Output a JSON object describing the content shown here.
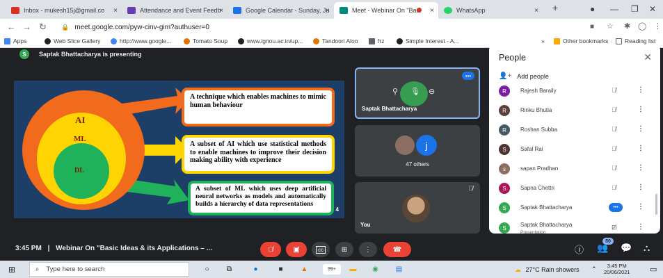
{
  "browser": {
    "tabs": [
      {
        "label": "Inbox - mukesh15j@gmail.co",
        "icon": "gmail-icon",
        "color": "#d93025"
      },
      {
        "label": "Attendance and Event Feedb",
        "icon": "forms-icon",
        "color": "#673ab7"
      },
      {
        "label": "Google Calendar - Sunday, Ju",
        "icon": "calendar-icon",
        "color": "#1a73e8"
      },
      {
        "label": "Meet - Webinar On \"Basi",
        "icon": "meet-icon",
        "color": "#00897b"
      },
      {
        "label": "WhatsApp",
        "icon": "whatsapp-icon",
        "color": "#25d366"
      }
    ],
    "close_glyph": "×",
    "new_tab_glyph": "+",
    "url": "meet.google.com/pyw-cinv-gim?authuser=0",
    "bookmarks": [
      {
        "label": "Apps",
        "color": "#4285f4"
      },
      {
        "label": "Web Slice Gallery",
        "color": "#202124"
      },
      {
        "label": "http://www.google...",
        "color": "#4285f4"
      },
      {
        "label": "Tomato Soup",
        "color": "#e37400"
      },
      {
        "label": "www.ignou.ac.in/up...",
        "color": "#202124"
      },
      {
        "label": "Tandoori Aloo",
        "color": "#e37400"
      },
      {
        "label": "frz",
        "color": "#5f6368"
      },
      {
        "label": "Simple Interest - A...",
        "color": "#202124"
      }
    ],
    "bookmarks_overflow": "»",
    "other_bookmarks": "Other bookmarks",
    "reading_list": "Reading list"
  },
  "meet": {
    "presenter_initial": "S",
    "presenting_text": "Saptak Bhattacharya is presenting",
    "slide": {
      "rings": [
        "AI",
        "ML",
        "DL"
      ],
      "boxes": [
        "A technique which enables machines to mimic human behaviour",
        "A subset of AI which use statistical methods to enable machines to improve their decision making ability with experience",
        "A subset of ML which uses deep artificial neural networks as models and automatically builds a hierarchy of data representations"
      ],
      "page_number": "4"
    },
    "tiles": {
      "presenter_name": "Saptak Bhattacharya",
      "others_avatar_initial": "j",
      "others_label": "47 others",
      "self_label": "You"
    },
    "meeting_time": "3:45 PM",
    "meeting_separator": "|",
    "meeting_title": "Webinar On \"Basic Ideas & its Applications – ...",
    "participant_count_badge": "50"
  },
  "people_panel": {
    "title": "People",
    "add_people": "Add people",
    "participants": [
      {
        "name": "Rajesh Baraily",
        "initial": "R",
        "avatar_color": "#7b1fa2",
        "sub": "",
        "state": "muted"
      },
      {
        "name": "Rinku Bhutia",
        "initial": "R",
        "avatar_color": "#5d4037",
        "sub": "",
        "state": "muted"
      },
      {
        "name": "Roshan Subba",
        "initial": "R",
        "avatar_color": "#455a64",
        "sub": "",
        "state": "muted"
      },
      {
        "name": "Safal Rai",
        "initial": "S",
        "avatar_color": "#4e342e",
        "sub": "",
        "state": "muted"
      },
      {
        "name": "sapan Pradhan",
        "initial": "s",
        "avatar_color": "#8d6e63",
        "sub": "",
        "state": "muted"
      },
      {
        "name": "Sapna Chettri",
        "initial": "S",
        "avatar_color": "#ad1457",
        "sub": "",
        "state": "muted"
      },
      {
        "name": "Saptak Bhattacharya",
        "initial": "S",
        "avatar_color": "#34a853",
        "sub": "",
        "state": "speaking"
      },
      {
        "name": "Saptak Bhattacharya",
        "initial": "S",
        "avatar_color": "#34a853",
        "sub": "Presentation",
        "state": "presentation"
      }
    ]
  },
  "taskbar": {
    "search_placeholder": "Type here to search",
    "weather": "27°C  Rain showers",
    "time": "3:45 PM",
    "date": "20/06/2021",
    "badge": "99+"
  }
}
